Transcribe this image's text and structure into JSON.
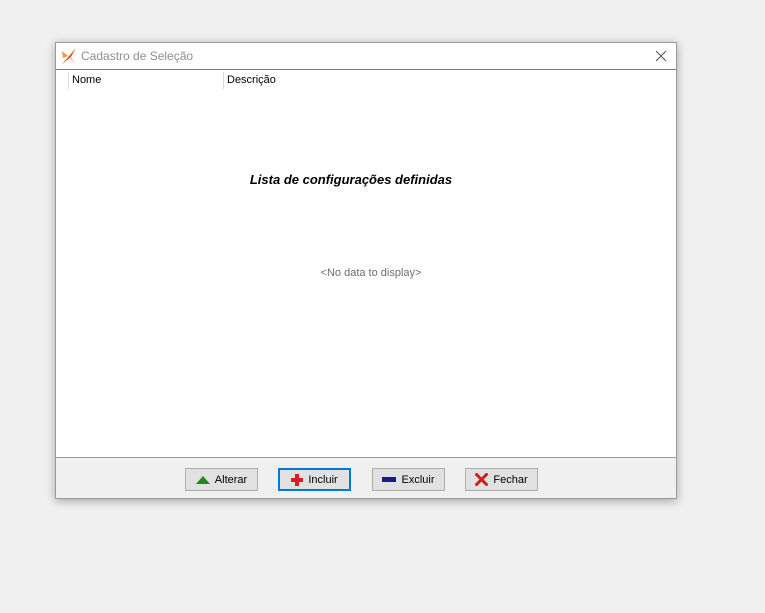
{
  "window": {
    "title": "Cadastro de Seleção"
  },
  "grid": {
    "columns": [
      "Nome",
      "Descrição"
    ],
    "rows": []
  },
  "list_caption": "Lista de configurações definidas",
  "empty_text": "<No data to display>",
  "buttons": {
    "alterar": "Alterar",
    "incluir": "Incluir",
    "excluir": "Excluir",
    "fechar": "Fechar"
  },
  "icons": {
    "app": "app-logo-icon",
    "close": "close-icon",
    "alterar": "triangle-up-icon",
    "incluir": "plus-icon",
    "excluir": "minus-icon",
    "fechar": "x-icon"
  },
  "colors": {
    "focus_border": "#0078d7",
    "alterar_icon": "#1e8a1e",
    "incluir_icon": "#d81e1e",
    "excluir_icon": "#1a1a8c",
    "fechar_icon": "#c81e1e"
  }
}
